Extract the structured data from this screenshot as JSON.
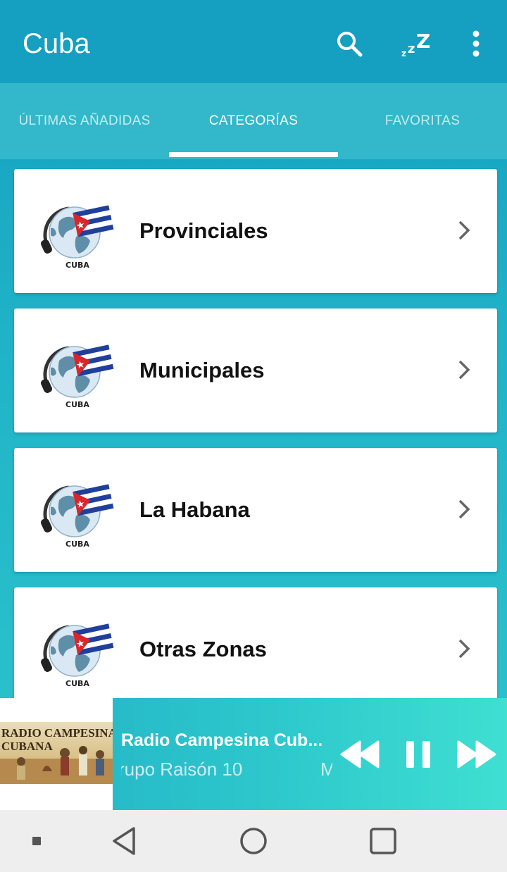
{
  "app_bar": {
    "title": "Cuba",
    "icons": [
      "search-icon",
      "sleep-timer-icon",
      "more-vert-icon"
    ]
  },
  "tabs": [
    {
      "label": "ÚLTIMAS AÑADIDAS",
      "active": false
    },
    {
      "label": "CATEGORÍAS",
      "active": true
    },
    {
      "label": "FAVORITAS",
      "active": false
    }
  ],
  "categories": [
    {
      "label": "Provinciales",
      "logo_text": "CUBA"
    },
    {
      "label": "Municipales",
      "logo_text": "CUBA"
    },
    {
      "label": "La Habana",
      "logo_text": "CUBA"
    },
    {
      "label": "Otras Zonas",
      "logo_text": "CUBA"
    }
  ],
  "player": {
    "art_text_line1": "RADIO CAMPESINA",
    "art_text_line2": "CUBANA",
    "title": "Radio Campesina Cub...",
    "subtitle_a": "rupo Raisón 10",
    "subtitle_b": "M",
    "controls": [
      "rewind-icon",
      "pause-icon",
      "fast-forward-icon"
    ]
  },
  "system_nav": [
    "back-icon",
    "home-icon",
    "recents-icon"
  ],
  "colors": {
    "app_bar": "#159fc0",
    "tab_bar": "#32b8ca",
    "background_gradient_end": "#2cc4cc",
    "player_gradient_end": "#3fdfd2"
  }
}
